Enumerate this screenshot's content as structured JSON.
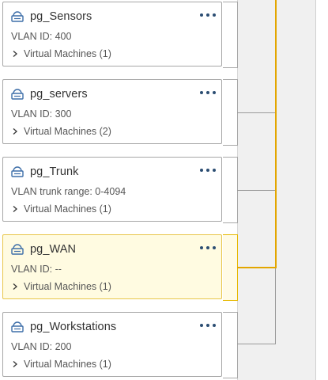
{
  "accent_color": "#e3a600",
  "port_groups": [
    {
      "name": "pg_Sensors",
      "detail": "VLAN ID: 400",
      "vms": "Virtual Machines (1)",
      "icon": "port-group-icon",
      "selected": false
    },
    {
      "name": "pg_servers",
      "detail": "VLAN ID: 300",
      "vms": "Virtual Machines (2)",
      "icon": "port-group-icon",
      "selected": false
    },
    {
      "name": "pg_Trunk",
      "detail": "VLAN trunk range: 0-4094",
      "vms": "Virtual Machines (1)",
      "icon": "port-group-icon",
      "selected": false
    },
    {
      "name": "pg_WAN",
      "detail": "VLAN ID: --",
      "vms": "Virtual Machines (1)",
      "icon": "port-group-icon",
      "selected": true
    },
    {
      "name": "pg_Workstations",
      "detail": "VLAN ID: 200",
      "vms": "Virtual Machines (1)",
      "icon": "port-group-icon",
      "selected": false
    }
  ]
}
